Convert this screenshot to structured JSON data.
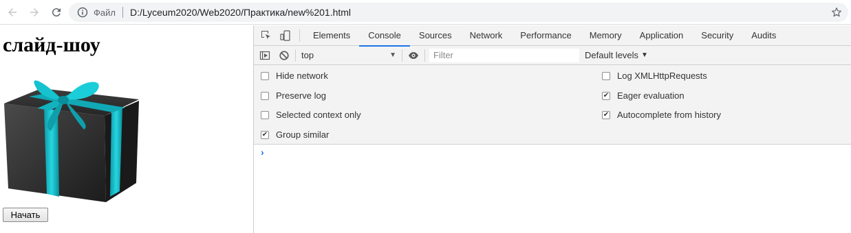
{
  "browser": {
    "scheme_label": "Файл",
    "url": "D:/Lyceum2020/Web2020/Практика/new%201.html"
  },
  "page": {
    "heading": "слайд-шоу",
    "start_button": "Начать"
  },
  "devtools": {
    "tabs": [
      "Elements",
      "Console",
      "Sources",
      "Network",
      "Performance",
      "Memory",
      "Application",
      "Security",
      "Audits"
    ],
    "active_tab": "Console",
    "context": "top",
    "filter_placeholder": "Filter",
    "levels": "Default levels",
    "settings_left": [
      {
        "label": "Hide network",
        "checked": false
      },
      {
        "label": "Preserve log",
        "checked": false
      },
      {
        "label": "Selected context only",
        "checked": false
      },
      {
        "label": "Group similar",
        "checked": true
      }
    ],
    "settings_right": [
      {
        "label": "Log XMLHttpRequests",
        "checked": false
      },
      {
        "label": "Eager evaluation",
        "checked": true
      },
      {
        "label": "Autocomplete from history",
        "checked": true
      }
    ],
    "prompt_symbol": "›"
  }
}
